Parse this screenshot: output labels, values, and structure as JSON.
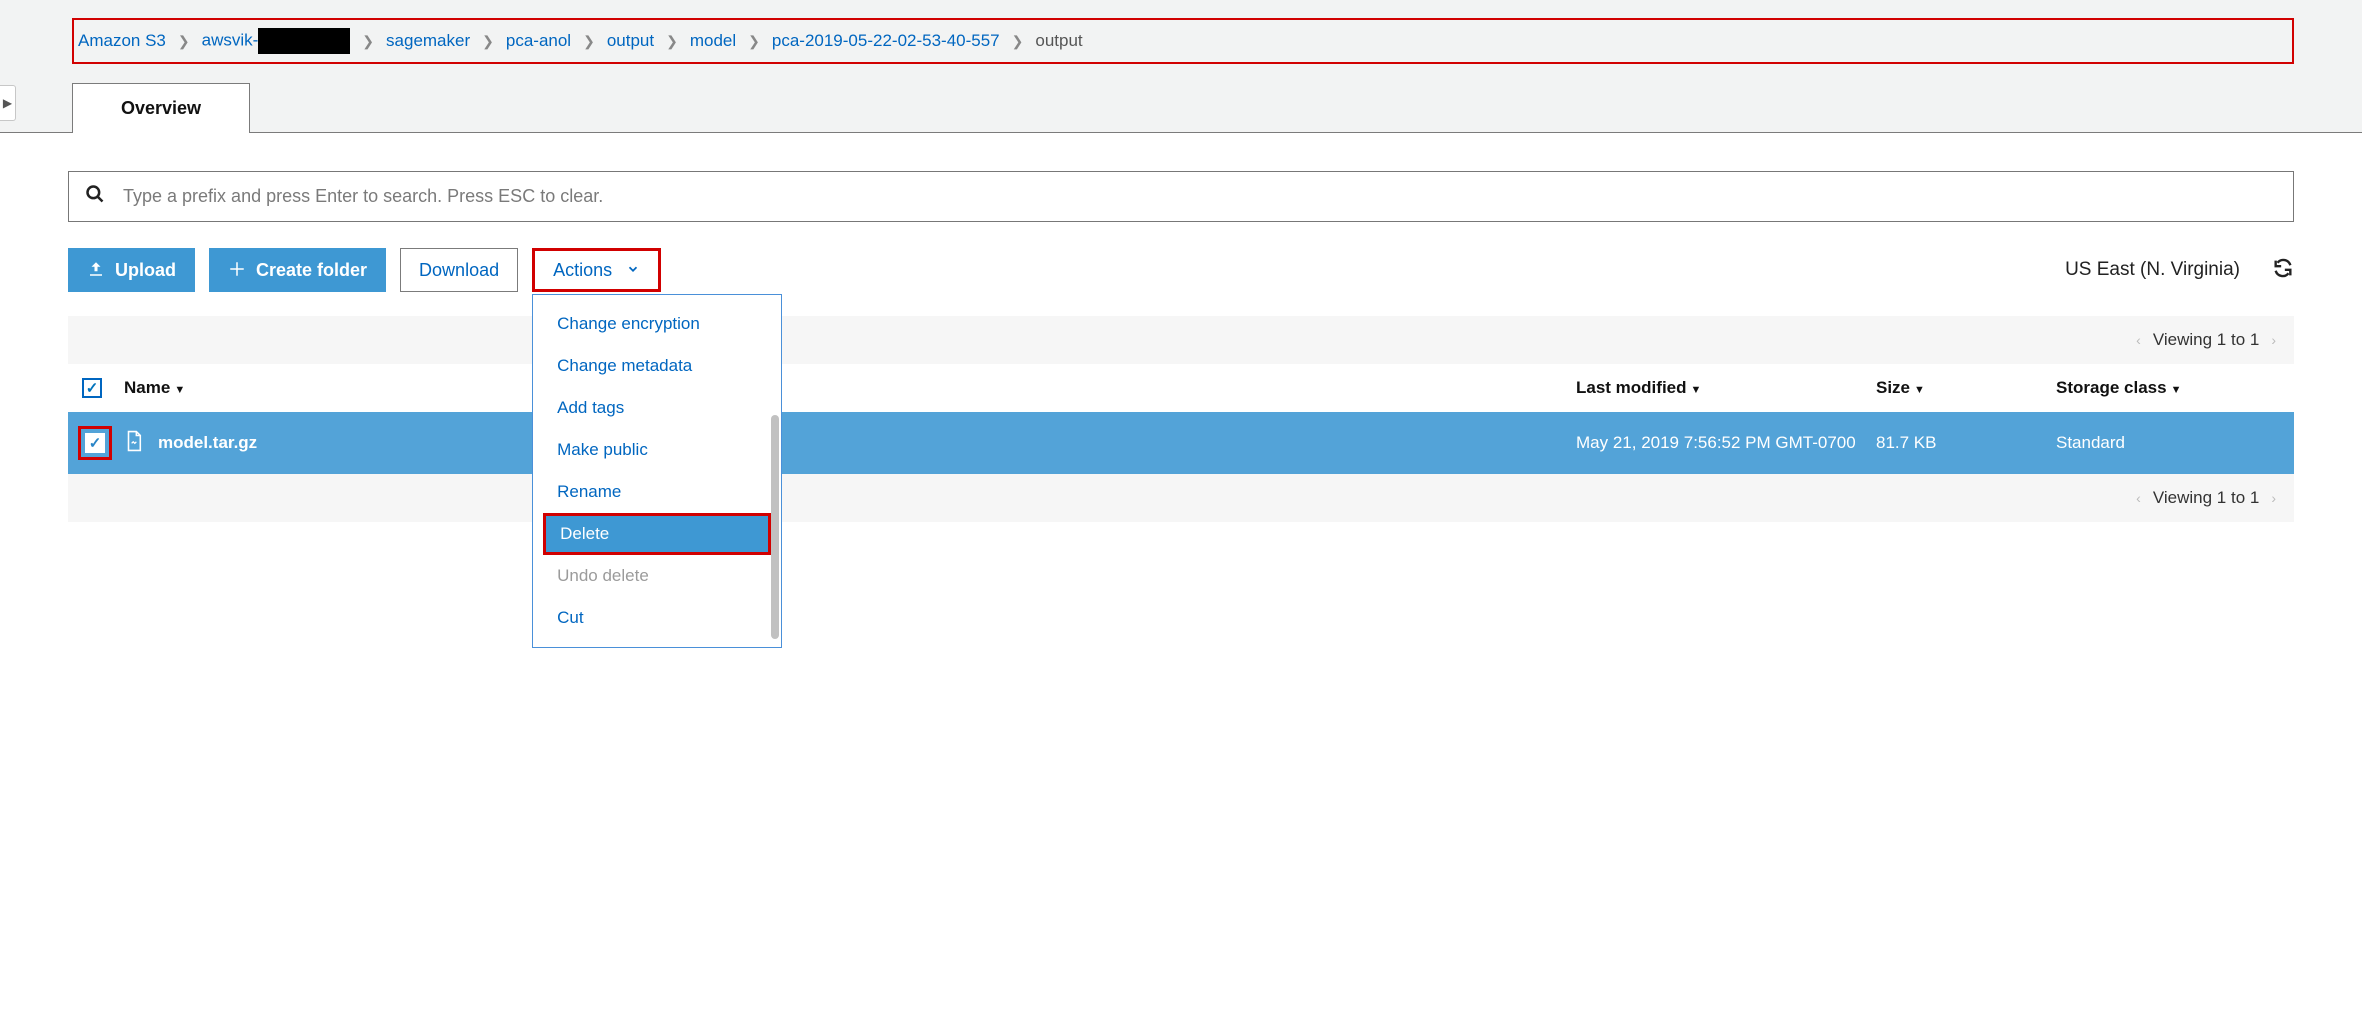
{
  "breadcrumb": {
    "items": [
      {
        "label": "Amazon S3"
      },
      {
        "label": "awsvik-",
        "redacted_suffix": true
      },
      {
        "label": "sagemaker"
      },
      {
        "label": "pca-anol"
      },
      {
        "label": "output"
      },
      {
        "label": "model"
      },
      {
        "label": "pca-2019-05-22-02-53-40-557"
      }
    ],
    "current": "output"
  },
  "tabs": {
    "active": "Overview"
  },
  "search": {
    "placeholder": "Type a prefix and press Enter to search. Press ESC to clear."
  },
  "toolbar": {
    "upload": "Upload",
    "create_folder": "Create folder",
    "download": "Download",
    "actions": "Actions",
    "region": "US East (N. Virginia)"
  },
  "actions_menu": {
    "items": [
      {
        "label": "Change encryption",
        "state": "normal"
      },
      {
        "label": "Change metadata",
        "state": "normal"
      },
      {
        "label": "Add tags",
        "state": "normal"
      },
      {
        "label": "Make public",
        "state": "normal"
      },
      {
        "label": "Rename",
        "state": "normal"
      },
      {
        "label": "Delete",
        "state": "highlight"
      },
      {
        "label": "Undo delete",
        "state": "disabled"
      },
      {
        "label": "Cut",
        "state": "normal"
      }
    ]
  },
  "list": {
    "viewing_top": "Viewing 1 to 1",
    "viewing_bottom": "Viewing 1 to 1",
    "columns": {
      "name": "Name",
      "modified": "Last modified",
      "size": "Size",
      "class": "Storage class"
    },
    "rows": [
      {
        "name": "model.tar.gz",
        "modified": "May 21, 2019 7:56:52 PM GMT-0700",
        "size": "81.7 KB",
        "class": "Standard",
        "selected": true
      }
    ]
  }
}
